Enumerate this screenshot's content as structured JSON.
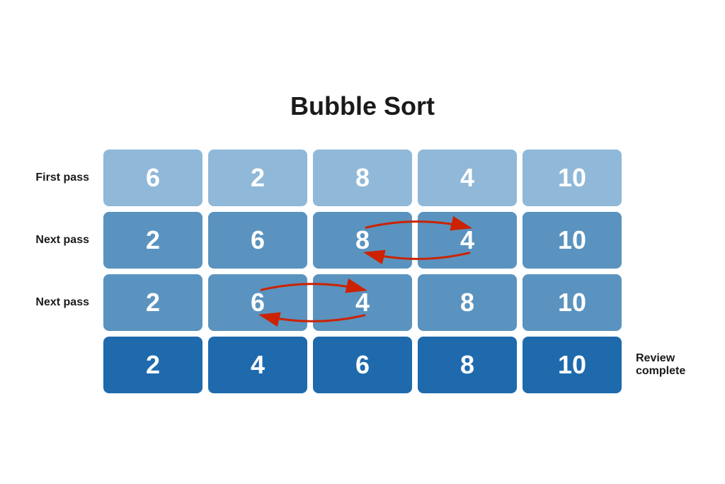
{
  "title": "Bubble Sort",
  "rows": [
    {
      "label": "First pass",
      "suffix": "",
      "cells": [
        6,
        2,
        8,
        4,
        10
      ],
      "shade": "light",
      "arrows": null
    },
    {
      "label": "Next pass",
      "suffix": "",
      "cells": [
        2,
        6,
        8,
        4,
        10
      ],
      "shade": "medium",
      "arrows": {
        "from": 2,
        "to": 3
      }
    },
    {
      "label": "Next pass",
      "suffix": "",
      "cells": [
        2,
        6,
        4,
        8,
        10
      ],
      "shade": "medium",
      "arrows": {
        "from": 1,
        "to": 2
      }
    },
    {
      "label": "",
      "suffix": "Review complete",
      "cells": [
        2,
        4,
        6,
        8,
        10
      ],
      "shade": "dark",
      "arrows": null
    }
  ],
  "colors": {
    "light": "#90b8d8",
    "medium": "#5a93bf",
    "dark": "#1e6aad",
    "arrow": "#cc2200",
    "text_dark": "#1a1a1a",
    "text_white": "#ffffff"
  }
}
